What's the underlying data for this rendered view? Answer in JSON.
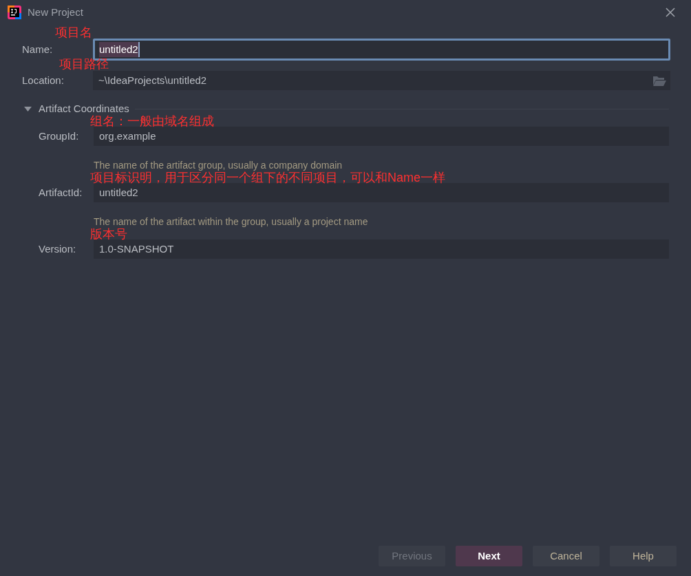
{
  "window": {
    "title": "New Project"
  },
  "fields": [
    {
      "kind": "text",
      "label": "Name:",
      "value": "untitled2",
      "focused": true,
      "annotation": "项目名"
    },
    {
      "kind": "path",
      "label": "Location:",
      "value": "~\\IdeaProjects\\untitled2",
      "focused": false,
      "annotation": "项目路径"
    }
  ],
  "section": {
    "title": "Artifact Coordinates",
    "expanded": true,
    "fields": [
      {
        "label": "GroupId:",
        "value": "org.example",
        "hint": "The name of the artifact group, usually a company domain",
        "annotation": "组名：一般由域名组成"
      },
      {
        "label": "ArtifactId:",
        "value": "untitled2",
        "hint": "The name of the artifact within the group, usually a project name",
        "annotation": "项目标识明，用于区分同一个组下的不同项目，可以和Name一样"
      },
      {
        "label": "Version:",
        "value": "1.0-SNAPSHOT",
        "annotation": "版本号"
      }
    ]
  },
  "buttons": [
    {
      "label": "Previous",
      "kind": "normal",
      "disabled": true
    },
    {
      "label": "Next",
      "kind": "default",
      "disabled": false
    },
    {
      "label": "Cancel",
      "kind": "normal",
      "disabled": false
    },
    {
      "label": "Help",
      "kind": "normal",
      "disabled": false
    }
  ]
}
